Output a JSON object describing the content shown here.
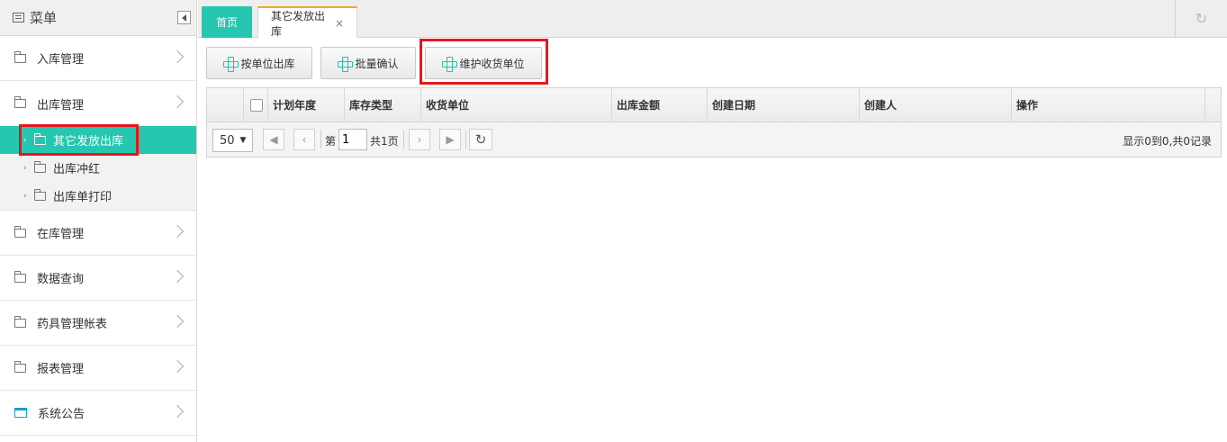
{
  "sidebar": {
    "title": "菜单",
    "items": [
      {
        "label": "入库管理"
      },
      {
        "label": "出库管理"
      },
      {
        "label": "在库管理"
      },
      {
        "label": "数据查询"
      },
      {
        "label": "药具管理帐表"
      },
      {
        "label": "报表管理"
      },
      {
        "label": "系统公告"
      }
    ],
    "sub_items": [
      {
        "label": "其它发放出库",
        "active": true
      },
      {
        "label": "出库冲红"
      },
      {
        "label": "出库单打印"
      }
    ]
  },
  "tabs": [
    {
      "label": "首页"
    },
    {
      "label": "其它发放出库",
      "close": "×"
    }
  ],
  "toolbar": {
    "buttons": [
      {
        "label": "按单位出库"
      },
      {
        "label": "批量确认"
      },
      {
        "label": "维护收货单位"
      }
    ]
  },
  "grid": {
    "columns": [
      "计划年度",
      "库存类型",
      "收货单位",
      "出库金额",
      "创建日期",
      "创建人",
      "操作"
    ],
    "pager": {
      "page_size": "50",
      "page_prefix": "第",
      "page_value": "1",
      "page_total": "共1页",
      "summary": "显示0到0,共0记录"
    }
  },
  "colors": {
    "accent": "#26c6b0",
    "highlight": "#e8161c",
    "tab_top": "#f5a623"
  }
}
